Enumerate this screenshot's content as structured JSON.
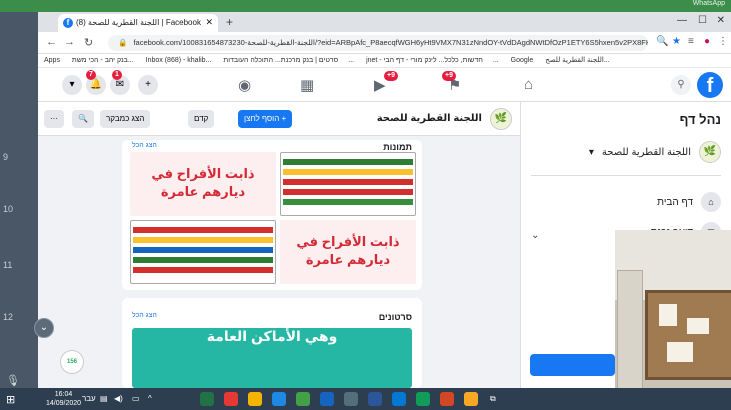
{
  "overlay": {
    "whatsapp_label": "WhatsApp",
    "ruler_marks": [
      "9",
      "10",
      "11",
      "12"
    ],
    "avatar_badge": "156"
  },
  "browser": {
    "tab_title": "(8) اللجنة القطرية للصحة | Facebook",
    "new_tab_glyph": "+",
    "url": "facebook.com/100831654873230-اللجنة-القطرية-للصحة/?eid=ARBpAfc_P8aecqfWGH6yHt9VMX7N31zNndOY-tVdDAgdNWtDfOzP1ETY6S5hxen5v2PX8FKdgE...",
    "bookmarks": [
      "Apps",
      "בנק יהב - הכי משת...",
      "Inbox (868) - khalib...",
      "סרטים | בנק מרכנת...",
      "התוכלה העובדות...",
      "jnet - חדשות, כלכל...",
      "לינק מורי - דף הבי...",
      "Google",
      "اللجنة القطرية للصح..."
    ]
  },
  "fb_nav": {
    "badges": {
      "groups": "+9",
      "watch": "+9",
      "messenger": "1",
      "notifications": "7"
    }
  },
  "right_panel": {
    "title": "נהל דף",
    "page_name": "اللجنة القطرية للصحة",
    "items": [
      {
        "label": "דף הבית"
      },
      {
        "label": "דואר נכנס"
      }
    ],
    "sub_label": "תובנות חדשות"
  },
  "page_header": {
    "page_name": "اللجنة القطرية للصحة",
    "buttons": {
      "add": "+ הוסף לחצן",
      "promote": "קדם",
      "view_as": "הצג כמבקר"
    }
  },
  "cards": {
    "photos": {
      "title": "תמונות",
      "link": "הצג הכל",
      "art_text": [
        "ذابت الأفراح في",
        "ديارهم عامرة"
      ]
    },
    "videos": {
      "title": "סרטונים",
      "link": "הצג הכל",
      "video_text": "وهي الأماكن العامة"
    }
  },
  "taskbar": {
    "time": "16:04",
    "date": "14/09/2020",
    "lang": "עבר"
  }
}
